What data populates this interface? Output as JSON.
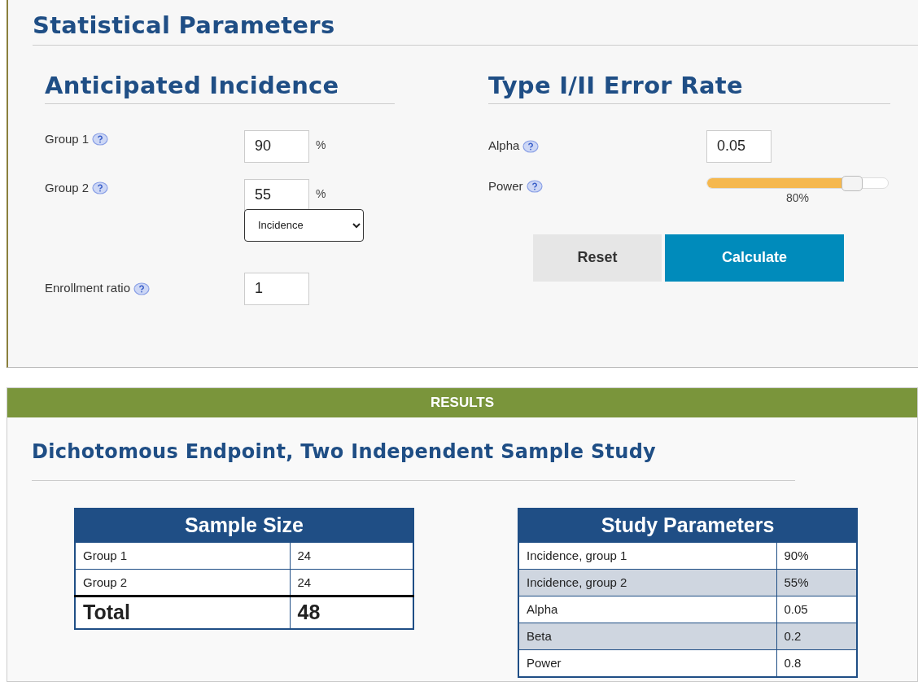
{
  "statistical_parameters": {
    "title": "Statistical Parameters",
    "incidence": {
      "title": "Anticipated Incidence",
      "fields": [
        {
          "label": "Group 1",
          "value": "90",
          "unit": "%"
        },
        {
          "label": "Group 2",
          "value": "55",
          "unit": "%"
        }
      ],
      "select": {
        "value": "Incidence"
      },
      "enrollment": {
        "label": "Enrollment ratio",
        "value": "1"
      }
    },
    "error_rate": {
      "title": "Type I/II Error Rate",
      "alpha": {
        "label": "Alpha",
        "value": "0.05"
      },
      "power": {
        "label": "Power",
        "level": 0.8,
        "reading": "80%"
      }
    },
    "buttons": [
      {
        "label": "Reset",
        "kind": "secondary"
      },
      {
        "label": "Calculate",
        "kind": "primary"
      }
    ]
  },
  "results": {
    "header": "RESULTS",
    "title": "Dichotomous Endpoint, Two Independent Sample Study",
    "sample_size": {
      "title": "Sample Size",
      "rows": [
        {
          "label": "Group 1",
          "value": "24",
          "kind": "plain"
        },
        {
          "label": "Group 2",
          "value": "24",
          "kind": "plain"
        },
        {
          "label": "Total",
          "value": "48",
          "kind": "total"
        }
      ]
    },
    "study_parameters": {
      "title": "Study Parameters",
      "rows": [
        {
          "label": "Incidence, group 1",
          "value": "90%",
          "kind": "plain"
        },
        {
          "label": "Incidence, group 2",
          "value": "55%",
          "kind": "shaded"
        },
        {
          "label": "Alpha",
          "value": "0.05",
          "kind": "plain"
        },
        {
          "label": "Beta",
          "value": "0.2",
          "kind": "shaded"
        },
        {
          "label": "Power",
          "value": "0.8",
          "kind": "plain"
        }
      ]
    }
  }
}
